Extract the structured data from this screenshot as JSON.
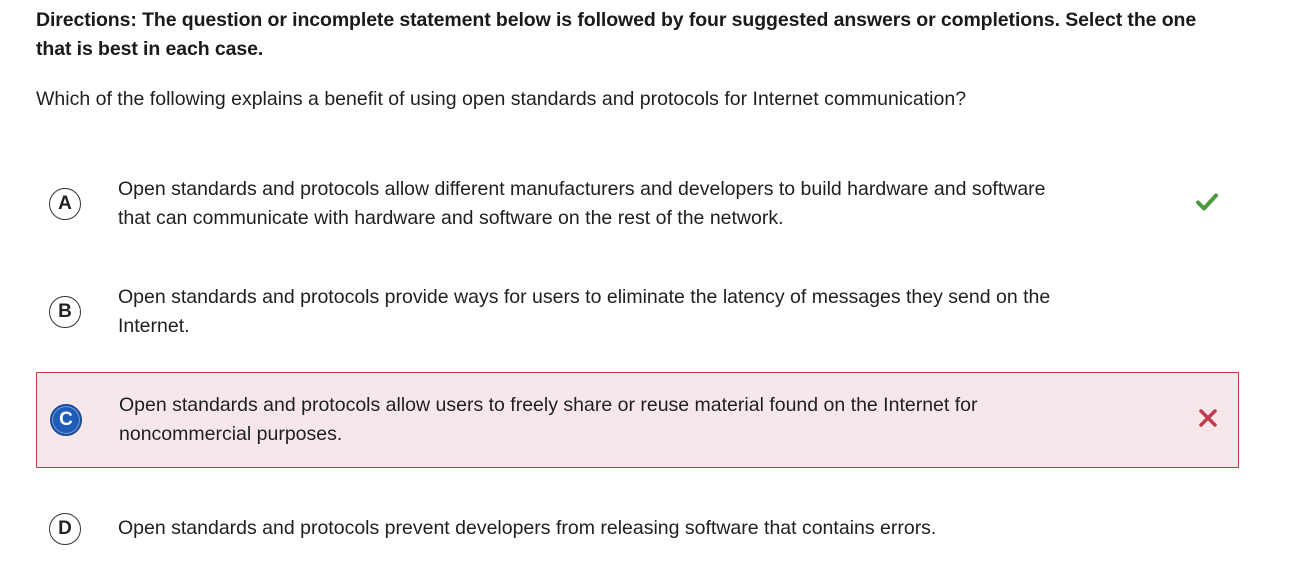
{
  "directions": "Directions: The question or incomplete statement below is followed by four suggested answers or completions. Select the one that is best in each case.",
  "question": "Which of the following explains a benefit of using open standards and protocols for Internet communication?",
  "choices": [
    {
      "letter": "A",
      "text": "Open standards and protocols allow different manufacturers and developers to build hardware and software that can communicate with hardware and software on the rest of the network.",
      "status": "correct",
      "status_icon": "checkmark-icon"
    },
    {
      "letter": "B",
      "text": "Open standards and protocols provide ways for users to eliminate the latency of messages they send on the Internet.",
      "status": "none"
    },
    {
      "letter": "C",
      "text": "Open standards and protocols allow users to freely share or reuse material found on the Internet for noncommercial purposes.",
      "status": "incorrect-selected",
      "status_icon": "x-icon"
    },
    {
      "letter": "D",
      "text": "Open standards and protocols prevent developers from releasing software that contains errors.",
      "status": "none"
    }
  ],
  "colors": {
    "correct": "#4c9a3b",
    "incorrect": "#c33b4b",
    "incorrect_background": "#f6e8ea",
    "selected_letter": "#1f5bb8"
  }
}
